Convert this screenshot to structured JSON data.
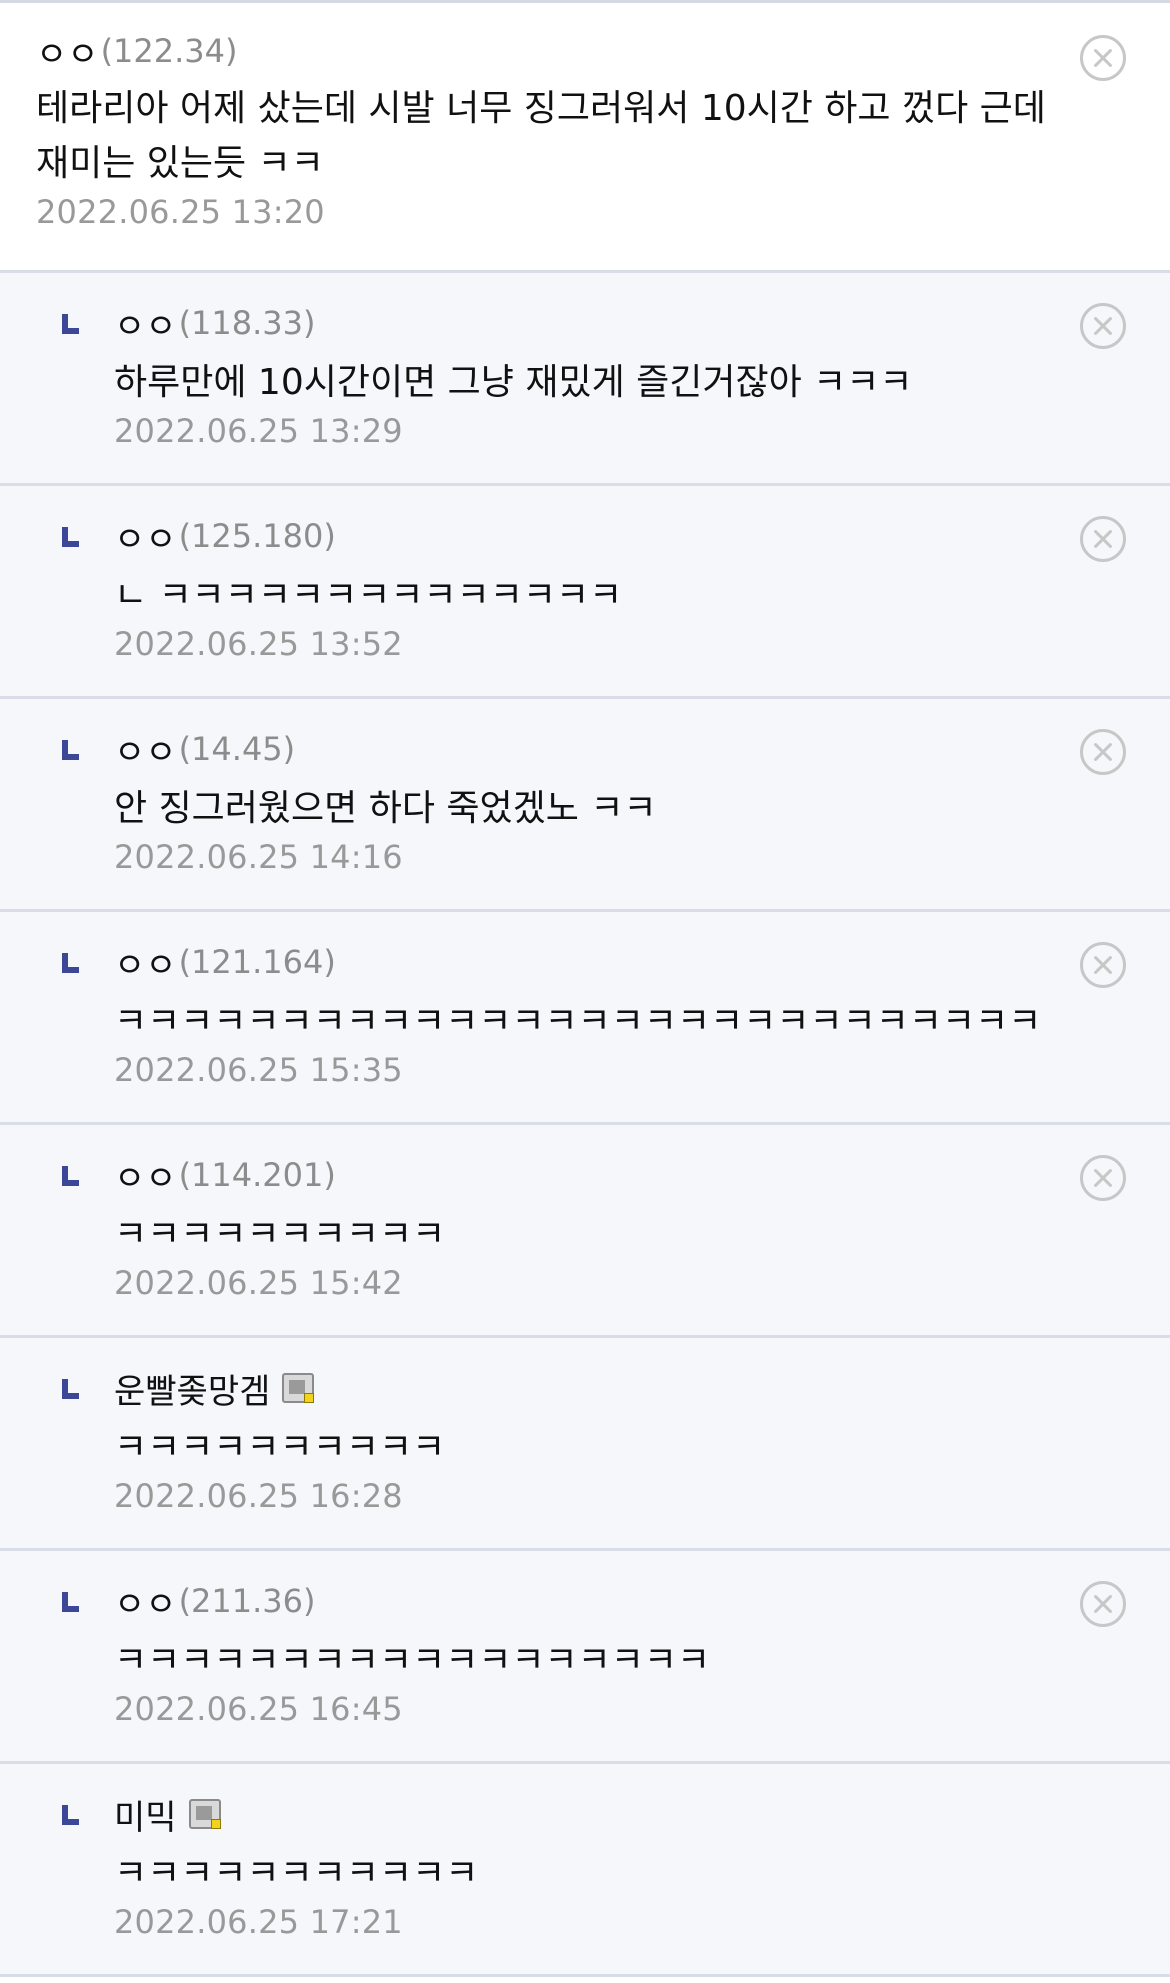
{
  "comments": [
    {
      "author": "ㅇㅇ",
      "ip": "(122.34)",
      "text": "테라리아 어제 샀는데 시발 너무 징그러워서 10시간 하고 껐다 근데 재미는 있는듯 ㅋㅋ",
      "date": "2022.06.25 13:20"
    },
    {
      "author": "ㅇㅇ",
      "ip": "(118.33)",
      "text": "하루만에 10시간이면 그냥 재밌게 즐긴거잖아 ㅋㅋㅋ",
      "date": "2022.06.25 13:29"
    },
    {
      "author": "ㅇㅇ",
      "ip": "(125.180)",
      "text": "ㄴ ㅋㅋㅋㅋㅋㅋㅋㅋㅋㅋㅋㅋㅋㅋ",
      "date": "2022.06.25 13:52"
    },
    {
      "author": "ㅇㅇ",
      "ip": "(14.45)",
      "text": "안 징그러웠으면 하다 죽었겠노 ㅋㅋ",
      "date": "2022.06.25 14:16"
    },
    {
      "author": "ㅇㅇ",
      "ip": "(121.164)",
      "text": "ㅋㅋㅋㅋㅋㅋㅋㅋㅋㅋㅋㅋㅋㅋㅋㅋㅋㅋㅋㅋㅋㅋㅋㅋㅋㅋㅋㅋ",
      "date": "2022.06.25 15:35"
    },
    {
      "author": "ㅇㅇ",
      "ip": "(114.201)",
      "text": "ㅋㅋㅋㅋㅋㅋㅋㅋㅋㅋ",
      "date": "2022.06.25 15:42"
    },
    {
      "author": "운빨좆망겜",
      "text": "ㅋㅋㅋㅋㅋㅋㅋㅋㅋㅋ",
      "date": "2022.06.25 16:28",
      "icon": "gallog-icon"
    },
    {
      "author": "ㅇㅇ",
      "ip": "(211.36)",
      "text": "ㅋㅋㅋㅋㅋㅋㅋㅋㅋㅋㅋㅋㅋㅋㅋㅋㅋㅋ",
      "date": "2022.06.25 16:45"
    },
    {
      "author": "미믹",
      "text": "ㅋㅋㅋㅋㅋㅋㅋㅋㅋㅋㅋ",
      "date": "2022.06.25 17:21",
      "icon": "gallog-icon"
    }
  ],
  "icons": {
    "reply": "reply-arrow-icon",
    "delete": "delete-circle-x-icon",
    "member": "gallog-icon"
  },
  "colors": {
    "reply_mark": "#3d4797",
    "reply_background": "#f6f7fa",
    "divider": "#d9dde7",
    "meta_text": "#999999"
  }
}
